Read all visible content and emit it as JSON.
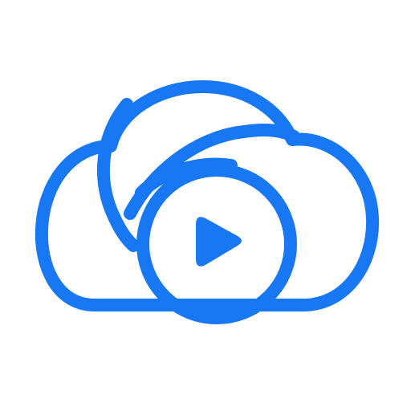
{
  "icon": {
    "name": "cloud-video-play-icon",
    "accent": "#1877F2",
    "background": "#FFFFFF"
  }
}
